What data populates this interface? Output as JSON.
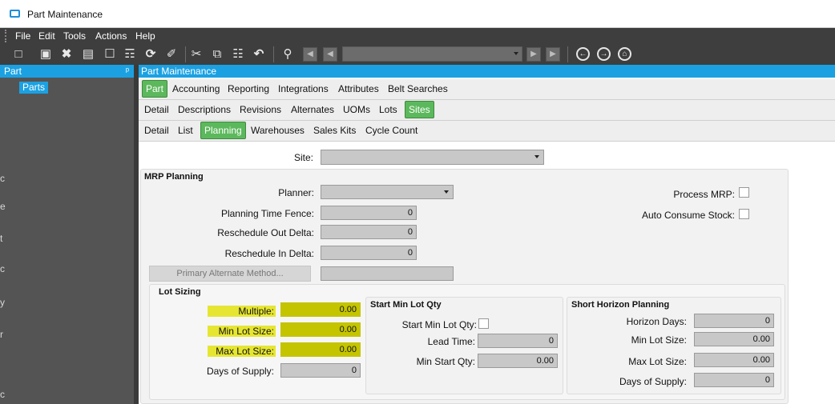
{
  "window": {
    "title": "Part Maintenance"
  },
  "menu": [
    "File",
    "Edit",
    "Tools",
    "Actions",
    "Help"
  ],
  "toolbar": {
    "icons": [
      "new-icon",
      "save-icon",
      "delete-icon",
      "book-icon",
      "note-icon",
      "attach-icon",
      "refresh-icon",
      "clear-icon",
      "cut-icon",
      "copy-icon",
      "paste-icon",
      "undo-icon",
      "search-icon",
      "first-icon",
      "prev-icon",
      "next-icon",
      "last-icon",
      "back-icon",
      "forward-icon",
      "home-icon"
    ]
  },
  "left_panel": {
    "title": "Part",
    "pin": "ᵖ",
    "tree_item": "Parts",
    "edge_letters": [
      "c",
      "e",
      "t",
      "c",
      "y",
      "r",
      "c"
    ]
  },
  "main_panel": {
    "title": "Part Maintenance"
  },
  "tabs": {
    "level1": [
      "Part",
      "Accounting",
      "Reporting",
      "Integrations",
      "Attributes",
      "Belt Searches"
    ],
    "level2": [
      "Detail",
      "Descriptions",
      "Revisions",
      "Alternates",
      "UOMs",
      "Lots",
      "Sites"
    ],
    "level3": [
      "Detail",
      "List",
      "Planning",
      "Warehouses",
      "Sales Kits",
      "Cycle Count"
    ]
  },
  "site": {
    "label": "Site:",
    "value": ""
  },
  "mrp": {
    "title": "MRP Planning",
    "planner_label": "Planner:",
    "planning_time_fence_label": "Planning Time Fence:",
    "planning_time_fence": "0",
    "reschedule_out_label": "Reschedule Out Delta:",
    "reschedule_out": "0",
    "reschedule_in_label": "Reschedule In Delta:",
    "reschedule_in": "0",
    "primary_alt_button": "Primary Alternate Method...",
    "process_mrp_label": "Process MRP:",
    "auto_consume_label": "Auto Consume Stock:"
  },
  "lot_sizing": {
    "title": "Lot Sizing",
    "multiple_label": "Multiple:",
    "multiple": "0.00",
    "min_lot_label": "Min Lot Size:",
    "min_lot": "0.00",
    "max_lot_label": "Max Lot Size:",
    "max_lot": "0.00",
    "days_supply_label": "Days of Supply:",
    "days_supply": "0"
  },
  "start_min": {
    "title": "Start Min Lot Qty",
    "start_min_label": "Start Min Lot Qty:",
    "lead_time_label": "Lead Time:",
    "lead_time": "0",
    "min_start_label": "Min Start Qty:",
    "min_start": "0.00"
  },
  "short_horizon": {
    "title": "Short Horizon Planning",
    "horizon_days_label": "Horizon Days:",
    "horizon_days": "0",
    "min_lot_label": "Min Lot Size:",
    "min_lot": "0.00",
    "max_lot_label": "Max Lot Size:",
    "max_lot": "0.00",
    "days_supply_label": "Days of Supply:",
    "days_supply": "0"
  },
  "colors": {
    "accent": "#1ba1e2",
    "active_tab": "#5cb85c",
    "highlight": "#e6e632"
  }
}
